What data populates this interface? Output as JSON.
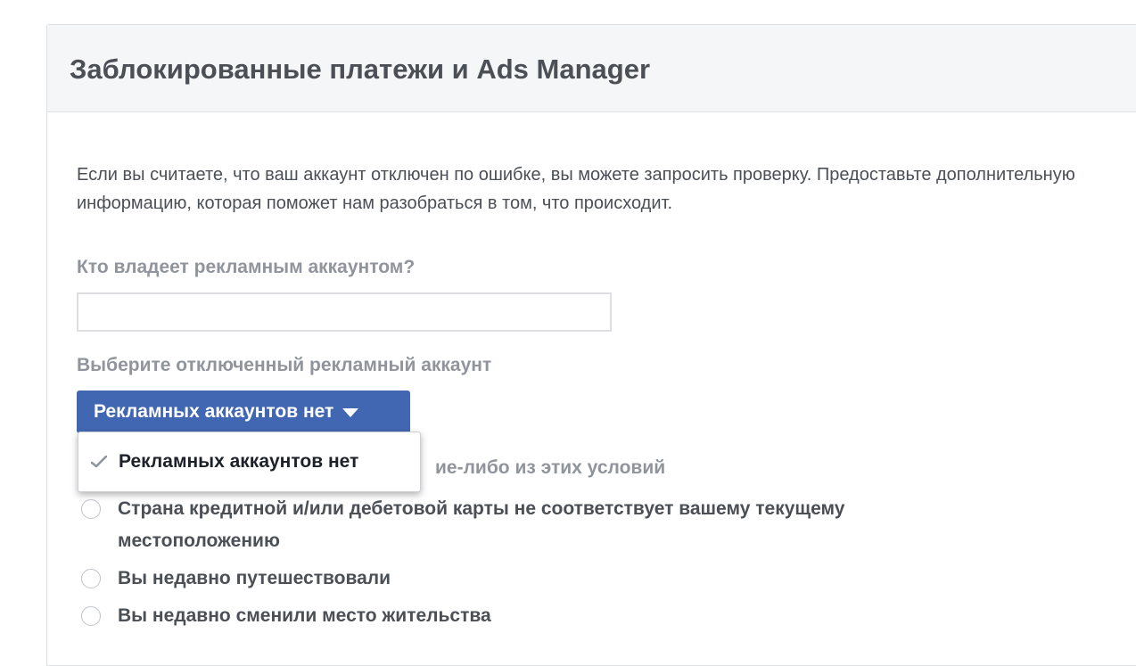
{
  "header": {
    "title": "Заблокированные платежи и Ads Manager"
  },
  "intro": {
    "text": "Если вы считаете, что ваш аккаунт отключен по ошибке, вы можете запросить проверку. Предоставьте дополнительную информацию, которая поможет нам разобраться в том, что происходит."
  },
  "owner_field": {
    "label": "Кто владеет рекламным аккаунтом?",
    "value": "",
    "placeholder": ""
  },
  "account_select": {
    "label": "Выберите отключенный рекламный аккаунт",
    "selected": "Рекламных аккаунтов нет",
    "menu_items": [
      {
        "label": "Рекламных аккаунтов нет",
        "checked": true
      }
    ]
  },
  "conditions": {
    "label": "ие-либо из этих условий",
    "options": [
      {
        "label": "Страна кредитной и/или дебетовой карты не соответствует вашему текущему местоположению",
        "checked": false
      },
      {
        "label": "Вы недавно путешествовали",
        "checked": false
      },
      {
        "label": "Вы недавно сменили место жительства",
        "checked": false
      }
    ]
  },
  "colors": {
    "button_bg": "#4267b2",
    "header_bg": "#f5f6f7",
    "label_gray": "#90949c",
    "text_dark": "#4b4f56"
  }
}
